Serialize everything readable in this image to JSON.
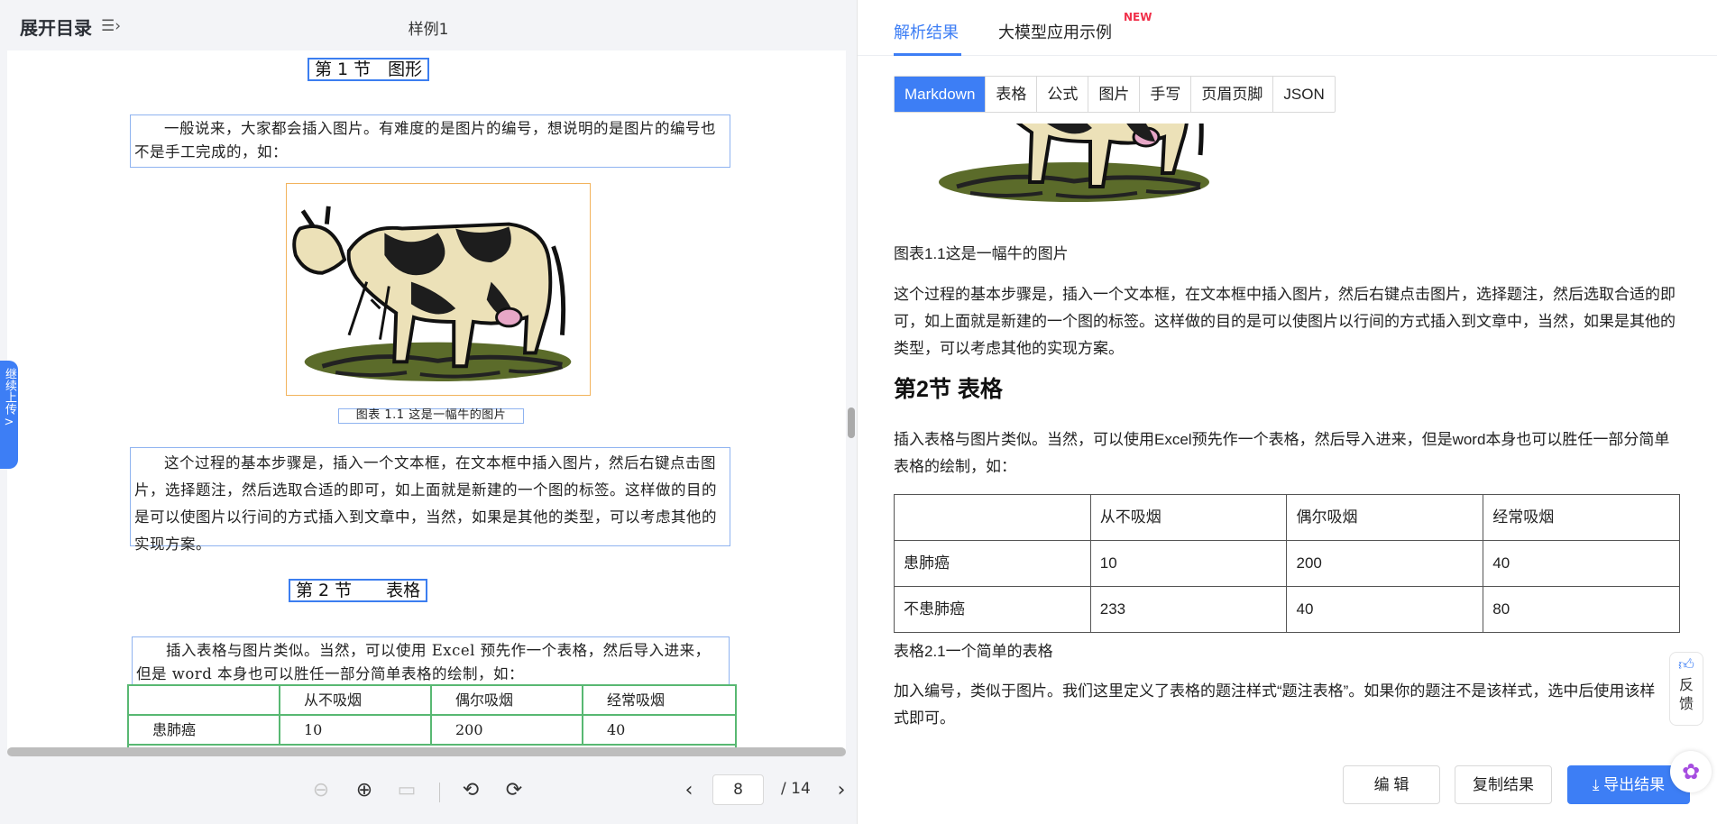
{
  "left_header": {
    "toc_label": "展开目录",
    "toc_icon": "list-indent-icon",
    "doc_title": "样例1"
  },
  "side_tab": {
    "label": "继续上传",
    "arrow": ">"
  },
  "doc": {
    "section1_heading": "第 1 节　图形",
    "para1": "一般说来，大家都会插入图片。有难度的是图片的编号，想说明的是图片的编号也不是手工完成的，如：",
    "fig_caption": "图表 1.1 这是一幅牛的图片",
    "para2": "这个过程的基本步骤是，插入一个文本框，在文本框中插入图片，然后右键点击图片，选择题注，然后选取合适的即可，如上面就是新建的一个图的标签。这样做的目的是可以使图片以行间的方式插入到文章中，当然，如果是其他的类型，可以考虑其他的实现方案。",
    "section2_heading": "第 2 节　　表格",
    "para3": "插入表格与图片类似。当然，可以使用 Excel 预先作一个表格，然后导入进来，但是 word 本身也可以胜任一部分简单表格的绘制，如：",
    "table": [
      [
        "",
        "从不吸烟",
        "偶尔吸烟",
        "经常吸烟"
      ],
      [
        "患肺癌",
        "10",
        "200",
        "40"
      ]
    ]
  },
  "toolbar": {
    "current_page": "8",
    "total_pages": "/ 14"
  },
  "right_tabs": {
    "parse_result": "解析结果",
    "llm_examples": "大模型应用示例",
    "new_badge": "NEW"
  },
  "format_tabs": [
    "Markdown",
    "表格",
    "公式",
    "图片",
    "手写",
    "页眉页脚",
    "JSON"
  ],
  "result": {
    "fig_caption": "图表1.1这是一幅牛的图片",
    "para1": "这个过程的基本步骤是，插入一个文本框，在文本框中插入图片，然后右键点击图片，选择题注，然后选取合适的即可，如上面就是新建的一个图的标签。这样做的目的是可以使图片以行间的方式插入到文章中，当然，如果是其他的类型，可以考虑其他的实现方案。",
    "heading2": "第2节 表格",
    "para2": "插入表格与图片类似。当然，可以使用Excel预先作一个表格，然后导入进来，但是word本身也可以胜任一部分简单表格的绘制，如：",
    "table": [
      [
        "",
        "从不吸烟",
        "偶尔吸烟",
        "经常吸烟"
      ],
      [
        "患肺癌",
        "10",
        "200",
        "40"
      ],
      [
        "不患肺癌",
        "233",
        "40",
        "80"
      ]
    ],
    "table_caption": "表格2.1一个简单的表格",
    "para3": "加入编号，类似于图片。我们这里定义了表格的题注样式“题注表格”。如果你的题注不是该样式，选中后使用该样式即可。"
  },
  "actions": {
    "edit": "编 辑",
    "copy": "复制结果",
    "export": "导出结果"
  },
  "feedback": {
    "label": "反馈"
  },
  "colors": {
    "accent": "#3d7ef5",
    "new_badge": "#f0304a",
    "table_border": "#58b872",
    "text_box": "#8fb3f0"
  }
}
